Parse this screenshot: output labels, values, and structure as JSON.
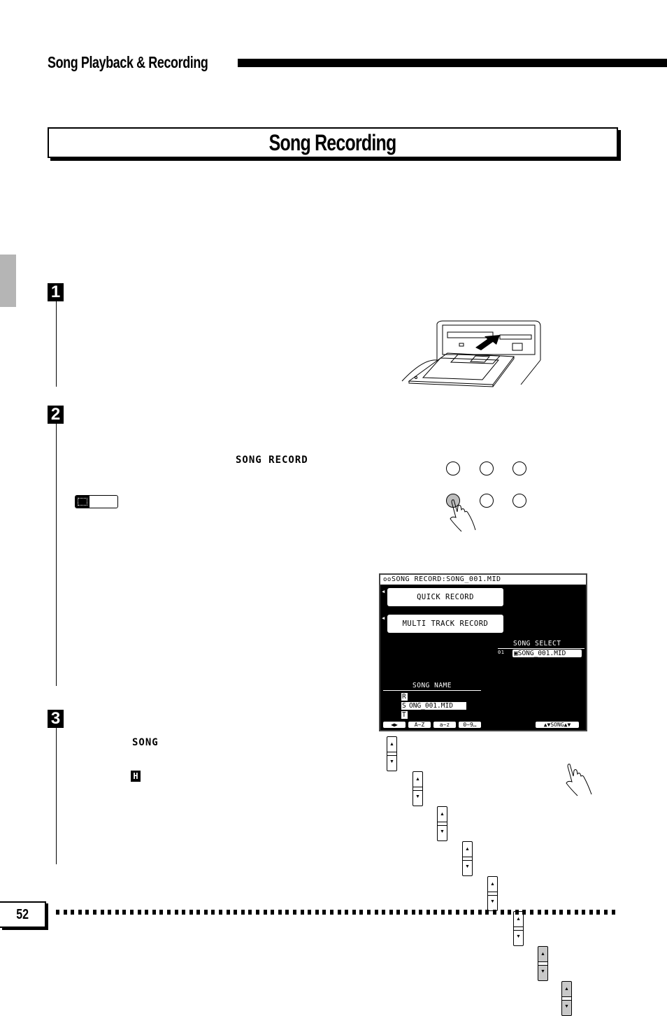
{
  "section_header": "Song Playback & Recording",
  "page_title": "Song Recording",
  "steps": [
    {
      "number": "1"
    },
    {
      "number": "2",
      "keyword": "SONG RECORD"
    },
    {
      "number": "3",
      "keyword": "SONG",
      "inline_icon": "H"
    }
  ],
  "note_icon": "note-icon",
  "illustrations": {
    "floppy": "floppy-disk-insert-illustration",
    "panel_buttons": {
      "rows": 2,
      "cols": 3,
      "pressed_index": 3
    },
    "rocker_buttons": {
      "count": 8,
      "highlighted": [
        7,
        8
      ]
    }
  },
  "lcd": {
    "title_icon": "tape-icon",
    "title": "SONG RECORD:SONG_001.MID",
    "buttons": [
      "QUICK RECORD",
      "MULTI TRACK RECORD"
    ],
    "song_select_label": "SONG SELECT",
    "song_select_index": "01",
    "song_select_value": "SONG_001.MID",
    "song_name_label": "SONG NAME",
    "song_name_chars": [
      "R",
      "S",
      "T"
    ],
    "song_name_value": "ONG_001.MID",
    "softkeys": [
      "◀▶",
      "A~Z",
      "a~z",
      "0~9…",
      "▲▼SONG▲▼"
    ]
  },
  "page_number": "52"
}
